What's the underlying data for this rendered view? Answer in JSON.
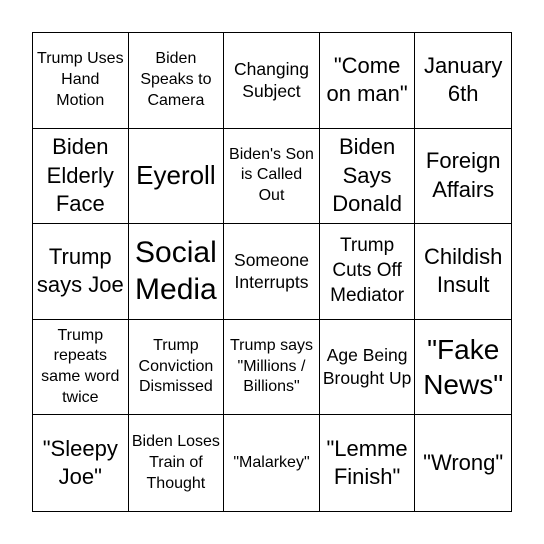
{
  "card": {
    "cells": [
      "Trump Uses Hand Motion",
      "Biden Speaks to Camera",
      "Changing Subject",
      "\"Come on man\"",
      "January 6th",
      "Biden Elderly Face",
      "Eyeroll",
      "Biden's Son is Called Out",
      "Biden Says Donald",
      "Foreign Affairs",
      "Trump says Joe",
      "Social Media",
      "Someone Interrupts",
      "Trump Cuts Off Mediator",
      "Childish Insult",
      "Trump repeats same word twice",
      "Trump Conviction Dismissed",
      "Trump says \"Millions / Billions\"",
      "Age Being Brought Up",
      "\"Fake News\"",
      "\"Sleepy Joe\"",
      "Biden Loses Train of Thought",
      "\"Malarkey\"",
      "\"Lemme Finish\"",
      "\"Wrong\""
    ]
  }
}
